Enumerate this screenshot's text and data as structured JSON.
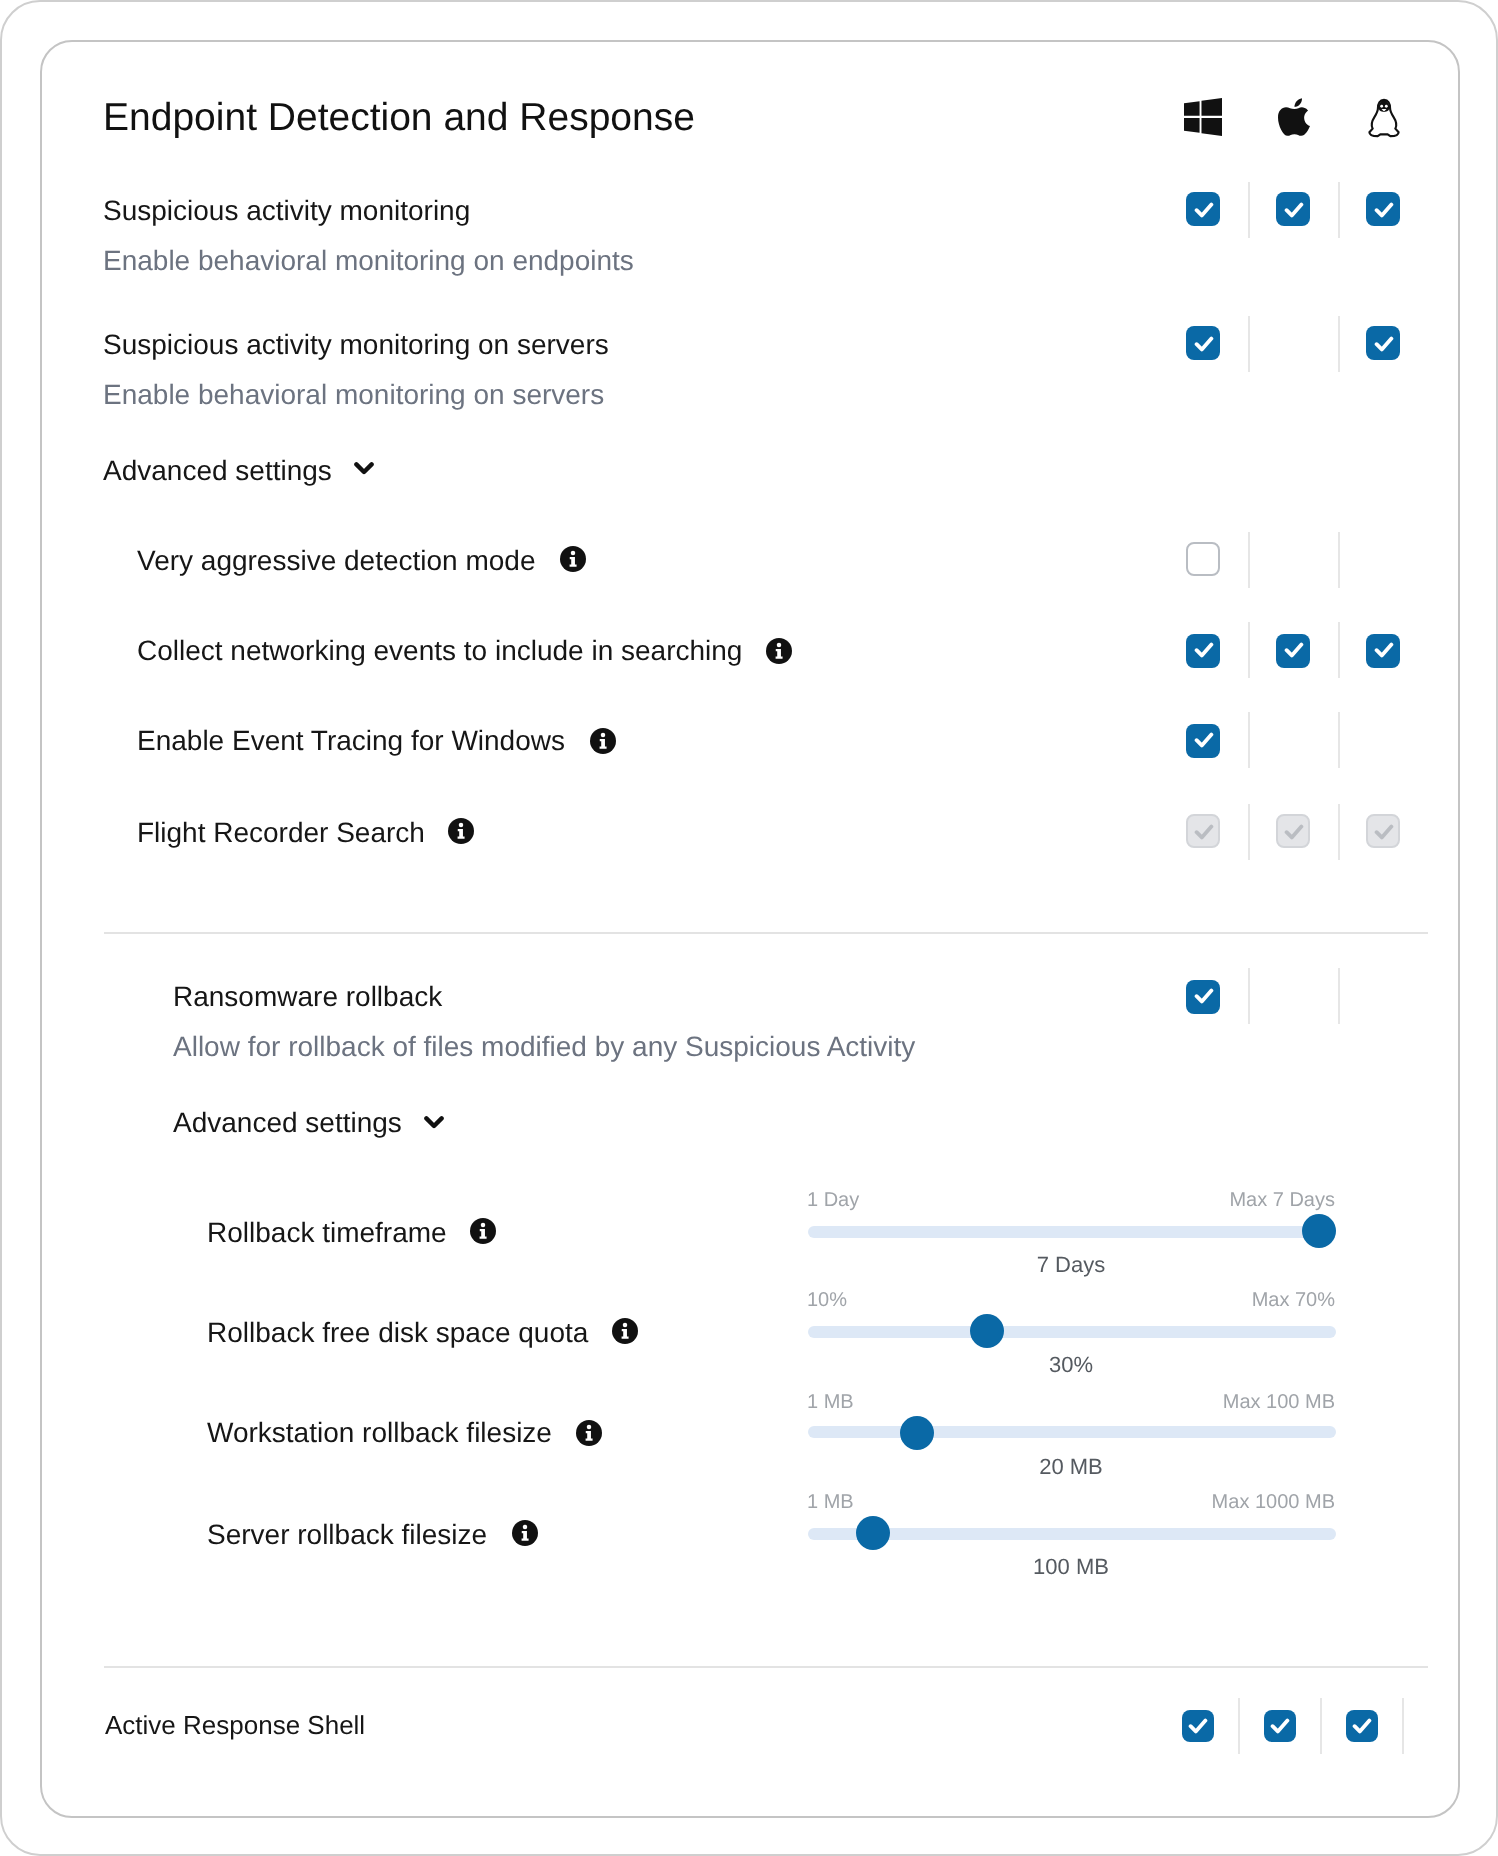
{
  "title": "Endpoint Detection and Response",
  "settings": [
    {
      "label": "Suspicious activity monitoring",
      "description": "Enable behavioral monitoring on endpoints",
      "cells": [
        {
          "kind": "checkbox",
          "checked": true,
          "disabled": false
        },
        {
          "kind": "checkbox",
          "checked": true,
          "disabled": false
        },
        {
          "kind": "checkbox",
          "checked": true,
          "disabled": false
        }
      ]
    },
    {
      "label": "Suspicious activity monitoring on servers",
      "description": "Enable behavioral monitoring on servers",
      "cells": [
        {
          "kind": "checkbox",
          "checked": true,
          "disabled": false
        },
        {
          "kind": "empty"
        },
        {
          "kind": "checkbox",
          "checked": true,
          "disabled": false
        }
      ]
    }
  ],
  "advanced": {
    "label": "Advanced settings",
    "expanded": true,
    "settings": [
      {
        "label": "Very aggressive detection mode",
        "cells": [
          {
            "kind": "checkbox",
            "checked": false,
            "disabled": false
          },
          {
            "kind": "empty"
          },
          {
            "kind": "empty"
          }
        ]
      },
      {
        "label": "Collect networking events to include in searching",
        "cells": [
          {
            "kind": "checkbox",
            "checked": true,
            "disabled": false
          },
          {
            "kind": "checkbox",
            "checked": true,
            "disabled": false
          },
          {
            "kind": "checkbox",
            "checked": true,
            "disabled": false
          }
        ]
      },
      {
        "label": "Enable Event Tracing for Windows",
        "cells": [
          {
            "kind": "checkbox",
            "checked": true,
            "disabled": false
          },
          {
            "kind": "empty"
          },
          {
            "kind": "empty"
          }
        ]
      },
      {
        "label": "Flight Recorder Search",
        "cells": [
          {
            "kind": "checkbox",
            "checked": true,
            "disabled": true
          },
          {
            "kind": "checkbox",
            "checked": true,
            "disabled": true
          },
          {
            "kind": "checkbox",
            "checked": true,
            "disabled": true
          }
        ]
      }
    ]
  },
  "rollback": {
    "label": "Ransomware rollback",
    "description": "Allow for rollback of files modified by any Suspicious Activity",
    "cells": [
      {
        "kind": "checkbox",
        "checked": true,
        "disabled": false
      },
      {
        "kind": "empty"
      },
      {
        "kind": "empty"
      }
    ],
    "advanced": {
      "label": "Advanced settings",
      "expanded": true,
      "sliders": [
        {
          "label": "Rollback timeframe",
          "min": "1 Day",
          "max": "Max 7 Days",
          "value": "7 Days",
          "level": 1
        },
        {
          "label": "Rollback free disk space quota",
          "min": "10%",
          "max": "Max 70%",
          "value": "30%",
          "level": 0.33
        },
        {
          "label": "Workstation rollback filesize",
          "min": "1 MB",
          "max": "Max 100 MB",
          "value": "20 MB",
          "level": 0.19
        },
        {
          "label": "Server rollback filesize",
          "min": "1 MB",
          "max": "Max 1000 MB",
          "value": "100 MB",
          "level": 0.1
        }
      ]
    }
  },
  "shell": {
    "label": "Active Response Shell",
    "cells": [
      {
        "kind": "checkbox",
        "checked": true,
        "disabled": false
      },
      {
        "kind": "checkbox",
        "checked": true,
        "disabled": false
      },
      {
        "kind": "checkbox",
        "checked": true,
        "disabled": false
      }
    ]
  }
}
